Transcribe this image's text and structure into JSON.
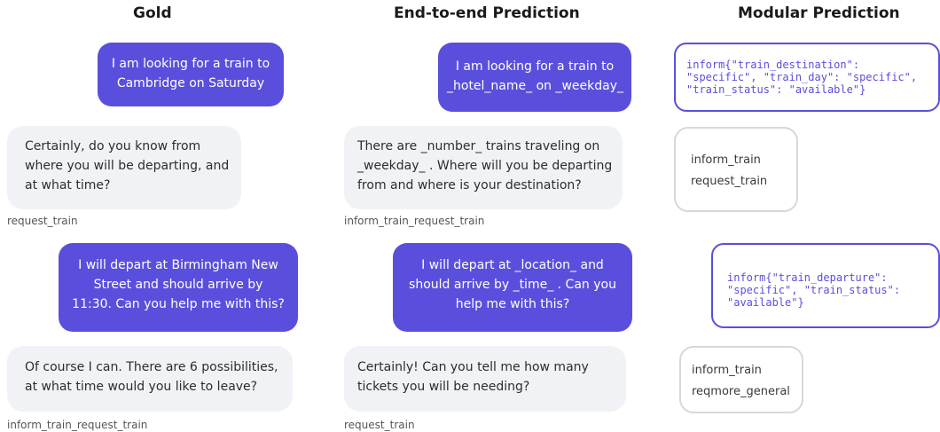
{
  "columns": {
    "gold": "Gold",
    "e2e": "End-to-end Prediction",
    "modular": "Modular Prediction"
  },
  "gold": {
    "user1": [
      "I am looking for a train to",
      "Cambridge on Saturday"
    ],
    "sys1": [
      "Certainly, do you know from",
      "where you will be departing, and",
      "at what time?"
    ],
    "sys1_label": "request_train",
    "user2": [
      "I will depart at Birmingham New",
      "Street and should arrive by",
      "11:30. Can you help me with this?"
    ],
    "sys2": [
      "Of course I can. There are 6 possibilities,",
      "at what time would you like to leave?"
    ],
    "sys2_label": "inform_train_request_train"
  },
  "e2e": {
    "user1": [
      "I am looking for a train to",
      "_hotel_name_ on _weekday_"
    ],
    "sys1": [
      "There are _number_ trains traveling on",
      "_weekday_ . Where will you be departing",
      "from and where is your destination?"
    ],
    "sys1_label": "inform_train_request_train",
    "user2": [
      "I will depart at _location_ and",
      "should arrive by _time_ . Can you",
      "help me with this?"
    ],
    "sys2": [
      "Certainly! Can you tell me how many",
      "tickets you will be needing?"
    ],
    "sys2_label": "request_train"
  },
  "modular": {
    "belief1": [
      "inform{\"train_destination\":",
      "\"specific\", \"train_day\": \"specific\",",
      "\"train_status\": \"available\"}"
    ],
    "acts1": [
      "inform_train",
      "request_train"
    ],
    "belief2": [
      "inform{\"train_departure\":",
      "\"specific\", \"train_status\":",
      "\"available\"}"
    ],
    "acts2": [
      "inform_train",
      "reqmore_general"
    ]
  }
}
